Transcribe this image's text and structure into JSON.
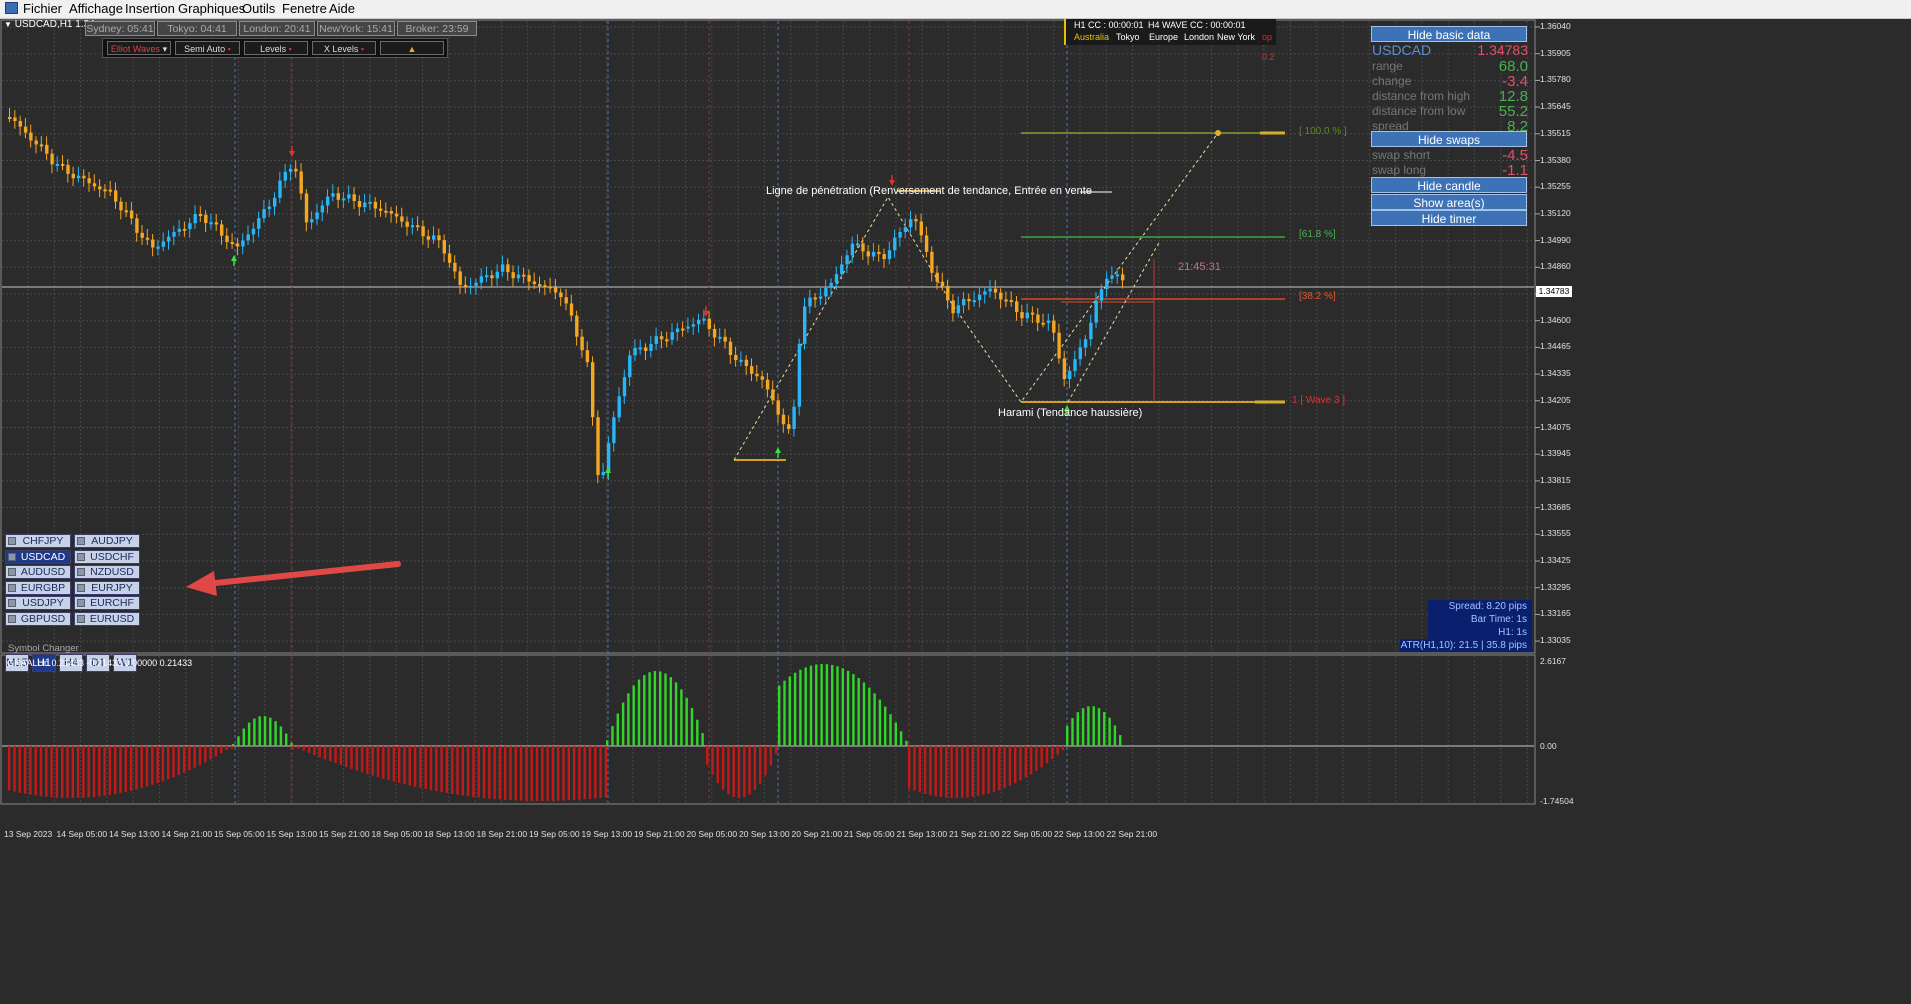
{
  "menu": {
    "items": [
      "Fichier",
      "Affichage",
      "Insertion",
      "Graphiques",
      "Outils",
      "Fenetre",
      "Aide"
    ]
  },
  "chart": {
    "header": "USDCAD,H1  1.34...",
    "sessions": [
      "Sydney: 05:41",
      "Tokyo: 04:41",
      "London: 20:41",
      "NewYork: 15:41",
      "Broker: 23:59"
    ],
    "toolbar": {
      "elliot": "Elliot Waves",
      "semi": "Semi Auto",
      "levels": "Levels",
      "xlevels": "X Levels",
      "arrow": "▲"
    },
    "timers": {
      "h1": "H1 CC : 00:00:01",
      "h4": "H4 WAVE CC : 00:00:01",
      "markets": [
        "Australia",
        "Tokyo",
        "Europe",
        "London",
        "New York"
      ],
      "extra": "op : 0.2"
    },
    "annotations": {
      "pattern1": "Ligne de pénétration (Renversement de tendance, Entrée en vente",
      "pattern2": "Harami (Tendance haussière)",
      "countdown": "21:45:31",
      "fib_100": "[ 100.0 % ]",
      "fib_618": "[61.8 %]",
      "fib_382": "[38.2 %]",
      "wave": "1 [ Wave 3 ]"
    },
    "price_axis": [
      "1.36040",
      "1.35905",
      "1.35780",
      "1.35645",
      "1.35515",
      "1.35380",
      "1.35255",
      "1.35120",
      "1.34990",
      "1.34860",
      "1.34730",
      "1.34600",
      "1.34465",
      "1.34335",
      "1.34205",
      "1.34075",
      "1.33945",
      "1.33815",
      "1.33685",
      "1.33555",
      "1.33425",
      "1.33295",
      "1.33165",
      "1.33035"
    ],
    "current_price": "1.34783",
    "time_axis": [
      "13 Sep 2023",
      "14 Sep 05:00",
      "14 Sep 13:00",
      "14 Sep 21:00",
      "15 Sep 05:00",
      "15 Sep 13:00",
      "15 Sep 21:00",
      "18 Sep 05:00",
      "18 Sep 13:00",
      "18 Sep 21:00",
      "19 Sep 05:00",
      "19 Sep 13:00",
      "19 Sep 21:00",
      "20 Sep 05:00",
      "20 Sep 13:00",
      "20 Sep 21:00",
      "21 Sep 05:00",
      "21 Sep 13:00",
      "21 Sep 21:00",
      "22 Sep 05:00",
      "22 Sep 13:00",
      "22 Sep 21:00"
    ]
  },
  "info_panel": {
    "hide_basic": "Hide basic data",
    "symbol": "USDCAD",
    "price": "1.34783",
    "rows": [
      {
        "k": "range",
        "v": "68.0",
        "color": "#4caf50"
      },
      {
        "k": "change",
        "v": "-3.4",
        "color": "#e0506a"
      },
      {
        "k": "distance from high",
        "v": "12.8",
        "color": "#4caf50"
      },
      {
        "k": "distance from low",
        "v": "55.2",
        "color": "#4caf50"
      },
      {
        "k": "spread",
        "v": "8.2",
        "color": "#4caf50"
      }
    ],
    "hide_swaps": "Hide swaps",
    "swap_rows": [
      {
        "k": "swap short",
        "v": "-4.5",
        "color": "#e0506a"
      },
      {
        "k": "swap long",
        "v": "-1.1",
        "color": "#e0506a"
      }
    ],
    "hide_candle": "Hide candle",
    "show_area": "Show area(s)",
    "hide_timer": "Hide timer"
  },
  "symbols": {
    "left": [
      "CHFJPY",
      "USDCAD",
      "AUDUSD",
      "EURGBP",
      "USDJPY",
      "GBPUSD"
    ],
    "right": [
      "AUDJPY",
      "USDCHF",
      "NZDUSD",
      "EURJPY",
      "EURCHF",
      "EURUSD"
    ],
    "active": "USDCAD",
    "label": "Symbol Changer"
  },
  "timeframes": {
    "items": [
      "M15",
      "H1",
      "H4",
      "D1",
      "W1"
    ],
    "active": "H1"
  },
  "stats": {
    "spread": "Spread: 8.20 pips",
    "bar_time": "Bar Time: 1s",
    "h1": "H1:  1s",
    "atr": "ATR(H1,10): 21.5  |  35.8 pips"
  },
  "indicator": {
    "title": "GRAALUn 0.21433 -0.21433 0.00000 0.21433",
    "axis": [
      "2.6167",
      "0.00",
      "-1.74504"
    ]
  },
  "colors": {
    "bull": "#29b6f6",
    "bear": "#f5a623",
    "hist_up": "#32d62a",
    "hist_down": "#c41919",
    "grid": "#4a4a4a",
    "button": "#3d72b6"
  }
}
